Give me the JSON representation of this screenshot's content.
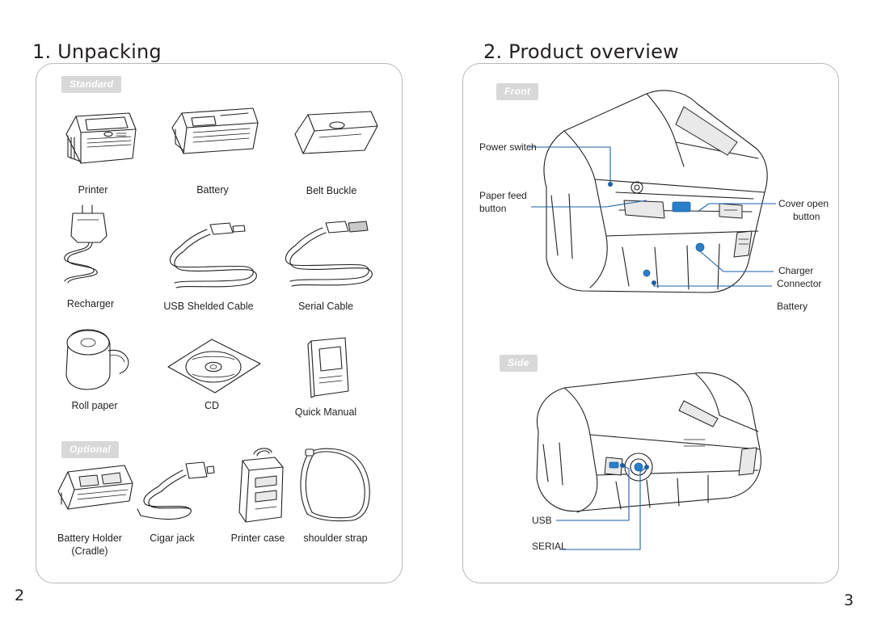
{
  "left_page": {
    "heading": "1. Unpacking",
    "page_number": "2",
    "sections": [
      {
        "tag": "Standard"
      },
      {
        "tag": "Optional"
      }
    ],
    "standard_items": [
      {
        "name": "printer",
        "label": "Printer"
      },
      {
        "name": "battery",
        "label": "Battery"
      },
      {
        "name": "belt-buckle",
        "label": "Belt Buckle"
      },
      {
        "name": "recharger",
        "label": "Recharger"
      },
      {
        "name": "usb-shielded-cable",
        "label": "USB Shelded Cable"
      },
      {
        "name": "serial-cable",
        "label": "Serial Cable"
      },
      {
        "name": "roll-paper",
        "label": "Roll paper"
      },
      {
        "name": "cd",
        "label": "CD"
      },
      {
        "name": "quick-manual",
        "label": "Quick Manual"
      }
    ],
    "optional_items": [
      {
        "name": "battery-holder",
        "label": "Battery Holder",
        "label2": "(Cradle)"
      },
      {
        "name": "cigar-jack",
        "label": "Cigar jack"
      },
      {
        "name": "printer-case",
        "label": "Printer case"
      },
      {
        "name": "shoulder-strap",
        "label": "shoulder strap"
      }
    ]
  },
  "right_page": {
    "heading": "2. Product overview",
    "page_number": "3",
    "views": [
      {
        "tag": "Front"
      },
      {
        "tag": "Side"
      }
    ],
    "front_callouts": [
      {
        "name": "power-switch",
        "label": "Power switch"
      },
      {
        "name": "paper-feed-button",
        "label": "Paper feed",
        "label2": "button"
      },
      {
        "name": "cover-open-button",
        "label": "Cover open",
        "label2": "button"
      },
      {
        "name": "charger-connector",
        "label": "Charger",
        "label2": "Connector"
      },
      {
        "name": "battery",
        "label": "Battery"
      }
    ],
    "side_callouts": [
      {
        "name": "usb",
        "label": "USB"
      },
      {
        "name": "serial",
        "label": "SERIAL"
      }
    ]
  },
  "colors": {
    "tag_bg": "#d8d8d8",
    "panel_border": "#b8b8b8",
    "text": "#231f20",
    "leader_line": "#1a5fa8",
    "accent_blue": "#2a7fc9"
  }
}
